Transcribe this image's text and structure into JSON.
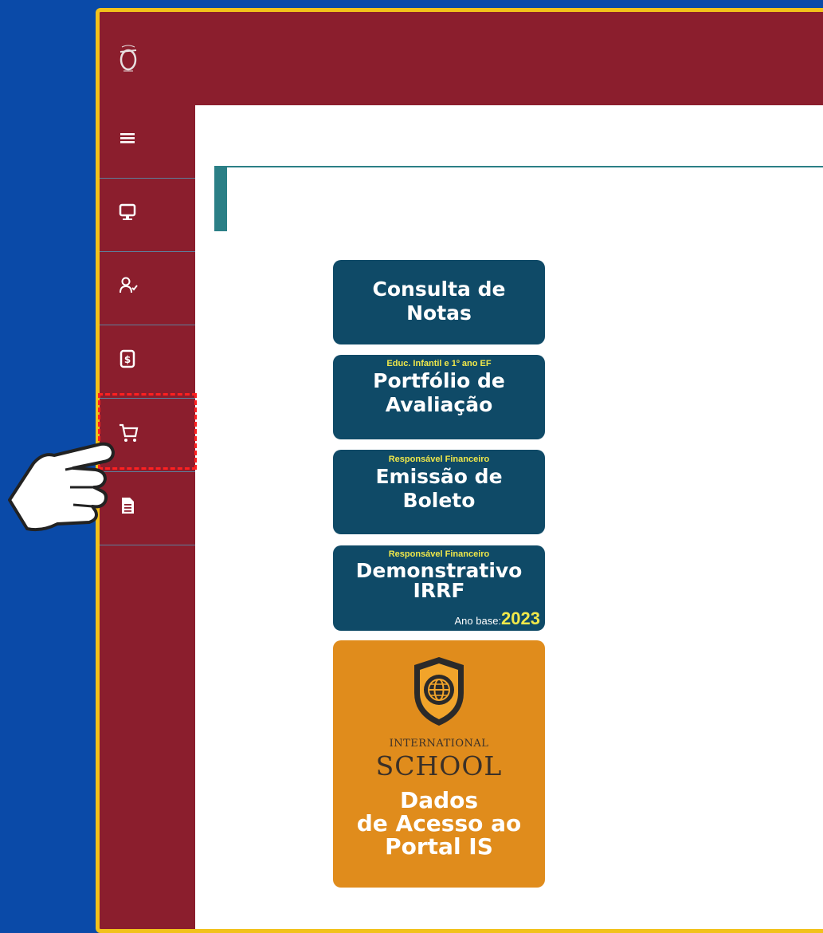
{
  "sidebar": {
    "items": [
      {
        "icon": "menu-icon"
      },
      {
        "icon": "monitor-icon"
      },
      {
        "icon": "user-check-icon"
      },
      {
        "icon": "invoice-dollar-icon"
      },
      {
        "icon": "cart-icon"
      },
      {
        "icon": "document-icon"
      }
    ]
  },
  "buttons": {
    "consulta": {
      "line1": "Consulta de",
      "line2": "Notas"
    },
    "portfolio": {
      "sub": "Educ. Infantil  e 1º ano EF",
      "line1": "Portfólio de",
      "line2": "Avaliação"
    },
    "boleto": {
      "sub": "Responsável Financeiro",
      "line1": "Emissão de",
      "line2": "Boleto"
    },
    "irrf": {
      "sub": "Responsável Financeiro",
      "line1": "Demonstrativo",
      "line2": "IRRF",
      "year_label": "Ano base:",
      "year": "2023"
    }
  },
  "is_card": {
    "line_intl": "INTERNATIONAL",
    "line_school": "SCHOOL",
    "line1": "Dados",
    "line2": "de Acesso ao",
    "line3": "Portal IS"
  },
  "colors": {
    "background": "#0a4aa8",
    "frame_border": "#f2c21b",
    "brand": "#8b1e2d",
    "button": "#0f4a67",
    "accent": "#2b7f86",
    "is_orange": "#e08c1c",
    "highlight": "#ff2020"
  }
}
